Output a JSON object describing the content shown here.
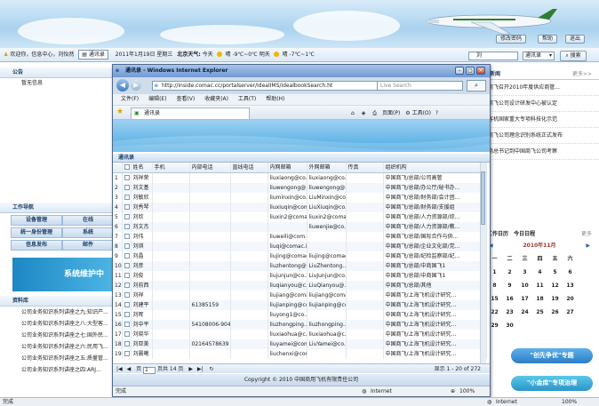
{
  "header": {
    "buttons": [
      "修改密码",
      "帮助",
      "退出"
    ]
  },
  "infobar": {
    "welcome": "欢迎你，信息中心，刘怡然",
    "directory_link": "通讯录",
    "date": "2011年1月19日 星期三",
    "weather_label": "北京天气:",
    "today": "今天",
    "today_cond": "晴",
    "today_temp": "-9℃~0℃",
    "tomorrow": "明天",
    "tomorrow_cond": "晴",
    "tomorrow_temp": "-7℃~1℃",
    "search_value": "刘",
    "search_scope": "通讯录",
    "search_button": "搜索"
  },
  "left": {
    "notice_title": "公告",
    "notice_empty": "暂无信息",
    "nav_title": "工作导航",
    "nav_items": [
      "设备管理",
      "在线",
      "统一身份管理",
      "系统",
      "信息发布",
      "邮件"
    ],
    "maint_banner": "系统维护中",
    "kb_title": "资料库",
    "kb_items": [
      "公司业务知识系列讲座之九:知识产...",
      "公司业务知识系列讲座之八:大型客...",
      "公司业务知识系列讲座之七:国外民...",
      "公司业务知识系列讲座之六:民用飞...",
      "公司业务知识系列讲座之五:质量管...",
      "公司业务知识系列讲座之四:ARJ..."
    ]
  },
  "right": {
    "news_title": "司新闻",
    "more": "更多>>",
    "news": [
      "商飞召开2010年度供应商管...",
      "商飞公司设计研发中心被认定",
      "客机国家重大专项科技化示范",
      "商飞公司理念识别系统正式发布",
      "商总书记到中国商飞公司考察"
    ],
    "cal_tabs": [
      "工作日历",
      "今日日程"
    ],
    "cal_more": "更多",
    "cal_month": "2010年11月",
    "cal_weekdays": [
      "一",
      "二",
      "三",
      "四",
      "五",
      "六"
    ],
    "cal_rows": [
      [
        "1",
        "2",
        "3",
        "4",
        "5",
        "6"
      ],
      [
        "8",
        "9",
        "10",
        "11",
        "12",
        "13"
      ],
      [
        "15",
        "16",
        "17",
        "18",
        "19",
        "20"
      ],
      [
        "22",
        "23",
        "24",
        "25",
        "26",
        "27"
      ],
      [
        "29",
        "30",
        "",
        "",
        "",
        ""
      ]
    ],
    "promo1": "\"创先争优\"专题",
    "promo2": "\"小金库\"专项治理"
  },
  "ie": {
    "title": "通讯录 - Windows Internet Explorer",
    "url": "http://inside.comac.cc/portalserver/IdealIMS/idealbookSearch.ht",
    "live_search": "Live Search",
    "menus": [
      "文件(F)",
      "编辑(E)",
      "查看(V)",
      "收藏夹(A)",
      "工具(T)",
      "帮助(H)"
    ],
    "tab": "通讯录",
    "page_menu": "页面(P)",
    "tools_menu": "工具(O)",
    "list_title": "通讯录",
    "columns": [
      "姓名",
      "手机",
      "内部电话",
      "直线电话",
      "内网邮箱",
      "外网邮箱",
      "传真",
      "组织机构"
    ],
    "rows": [
      [
        "1",
        "刘祥荣",
        "",
        "",
        "",
        "liuxiaong@co...",
        "liuxiaong@co...",
        "",
        "中国商飞/总部/公司高管"
      ],
      [
        "2",
        "刘文基",
        "",
        "",
        "",
        "liuwengong@...",
        "liuwengong@...",
        "",
        "中国商飞/总部/办公厅/秘书办..."
      ],
      [
        "3",
        "刘敏欣",
        "",
        "",
        "",
        "liuminxin@co...",
        "LiuMinxin@co...",
        "",
        "中国商飞/总部/财务部/会计团..."
      ],
      [
        "4",
        "刘秀琴",
        "",
        "",
        "",
        "liuxiuqin@com...",
        "LiuXiuqin@co...",
        "",
        "中国商飞/总部/财务部/支援组"
      ],
      [
        "5",
        "刘欣",
        "",
        "",
        "",
        "liuxin2@coma...",
        "liuxin2@coma...",
        "",
        "中国商飞/总部/人力资源部/综..."
      ],
      [
        "6",
        "刘文杰",
        "",
        "",
        "",
        "",
        "liuwenjie@co...",
        "",
        "中国商飞/总部/人力资源部/教..."
      ],
      [
        "7",
        "刘伟",
        "",
        "",
        "",
        "liuweili@com...",
        "",
        "",
        "中国商飞/总部/国际合作与供..."
      ],
      [
        "8",
        "刘琪",
        "",
        "",
        "",
        "liuqi@comac.i...",
        "",
        "",
        "中国商飞/总部/企业文化部/党..."
      ],
      [
        "9",
        "刘晶",
        "",
        "",
        "",
        "liujing@comac...",
        "liujing@comac...",
        "",
        "中国商飞/总部/纪检监察部/纪..."
      ],
      [
        "10",
        "刘彦",
        "",
        "",
        "",
        "liuzhentong@...",
        "LiuZhentong...",
        "",
        "中国商飞/总部/中商国飞1"
      ],
      [
        "11",
        "刘俊",
        "",
        "",
        "",
        "liujunjun@co...",
        "LiuJunjun@co...",
        "",
        "中国商飞/总部/中商国飞1"
      ],
      [
        "12",
        "刘前西",
        "",
        "",
        "",
        "liuqianyou@c...",
        "LiuQianyou@...",
        "",
        "中国商飞/总部/其他"
      ],
      [
        "13",
        "刘祥",
        "",
        "",
        "",
        "liujiang@coma...",
        "liujiang@coma...",
        "",
        "中国商飞/上海飞机设计研究..."
      ],
      [
        "14",
        "刘建平",
        "",
        "61385159",
        "",
        "liujianping@co...",
        "liujianping@co...",
        "",
        "中国商飞/上海飞机设计研究..."
      ],
      [
        "15",
        "刘晖",
        "",
        "",
        "",
        "liuyong1@co...",
        "",
        "",
        "中国商飞/上海飞机设计研究..."
      ],
      [
        "16",
        "刘中平",
        "",
        "54108006-904",
        "",
        "liuzhongping...",
        "liuzhongping...",
        "",
        "中国商飞/上海飞机设计研究..."
      ],
      [
        "17",
        "刘晓华",
        "",
        "",
        "",
        "liuxiaohua@c...",
        "liuxiaohua@c...",
        "",
        "中国商飞/上海飞机设计研究..."
      ],
      [
        "18",
        "刘亚美",
        "",
        "02164578639",
        "",
        "liuyamei@com...",
        "LiuYamei@co...",
        "",
        "中国商飞/上海飞机设计研究..."
      ],
      [
        "19",
        "刘晨曦",
        "",
        "",
        "",
        "liuchenxi@com...",
        "",
        "",
        "中国商飞/上海飞机设计研究..."
      ]
    ],
    "pager_page_label": "页",
    "pager_page": "1",
    "pager_total": "页共 14 页",
    "pager_summary": "显示 1 - 20 of 272",
    "copyright": "Copyright © 2010 中国商用飞机有限责任公司",
    "status_done": "完成",
    "status_zone": "Internet",
    "status_zoom": "100%"
  },
  "os_status": {
    "left": "完成",
    "zone": "Internet",
    "zoom": "100%"
  }
}
